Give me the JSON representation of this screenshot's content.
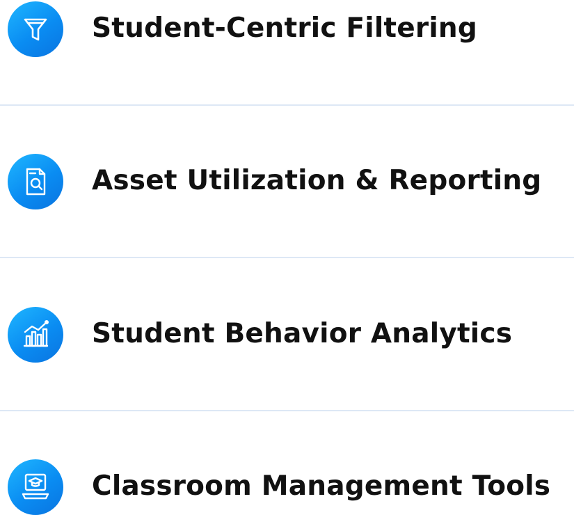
{
  "features": [
    {
      "label": "Student-Centric Filtering",
      "icon": "filter-icon"
    },
    {
      "label": "Asset Utilization & Reporting",
      "icon": "report-search-icon"
    },
    {
      "label": "Student Behavior Analytics",
      "icon": "analytics-chart-icon"
    },
    {
      "label": "Classroom Management Tools",
      "icon": "classroom-laptop-icon"
    }
  ],
  "colors": {
    "accent_light": "#1fb6ff",
    "accent_dark": "#0a74e0",
    "text": "#111111",
    "divider": "#dde8f5"
  }
}
